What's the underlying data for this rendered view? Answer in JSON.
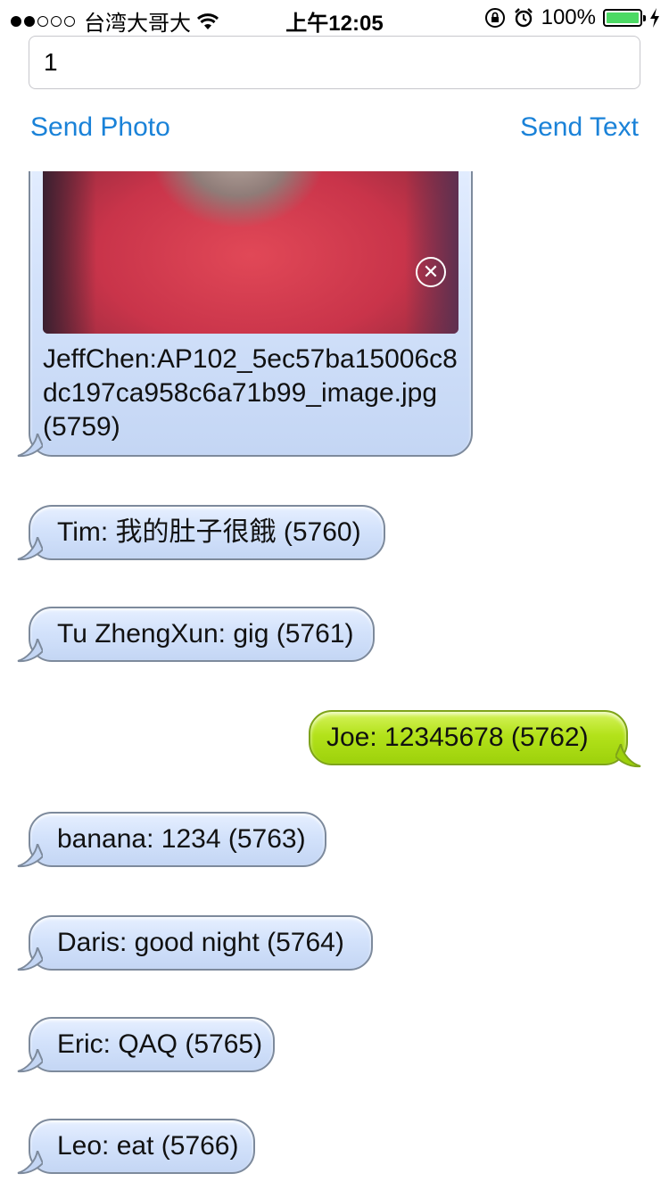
{
  "status_bar": {
    "carrier": "台湾大哥大",
    "time": "上午12:05",
    "battery": "100%",
    "wifi_icon": "wifi-icon",
    "lock_icon": "rotation-lock-icon",
    "alarm_icon": "alarm-icon",
    "charging_icon": "charging-bolt-icon",
    "battery_level": 1.0,
    "battery_color": "#4cd964"
  },
  "input": {
    "value": "1"
  },
  "actions": {
    "send_photo": "Send Photo",
    "send_text": "Send Text",
    "color": "#1a82d8"
  },
  "messages": [
    {
      "side": "in",
      "kind": "photo",
      "text": "JeffChen:AP102_5ec57ba15006c8dc197ca958c6a71b99_image.jpg (5759)"
    },
    {
      "side": "in",
      "text": "Tim: 我的肚子很餓 (5760)"
    },
    {
      "side": "in",
      "text": "Tu ZhengXun: gig (5761)"
    },
    {
      "side": "out",
      "text": "Joe: 12345678 (5762)"
    },
    {
      "side": "in",
      "text": "banana: 1234 (5763)"
    },
    {
      "side": "in",
      "text": "Daris: good night (5764)"
    },
    {
      "side": "in",
      "text": "Eric: QAQ (5765)"
    },
    {
      "side": "in",
      "text": "Leo: eat (5766)"
    }
  ],
  "colors": {
    "incoming_bubble": "#d3e2fb",
    "outgoing_bubble": "#b3e21a"
  }
}
